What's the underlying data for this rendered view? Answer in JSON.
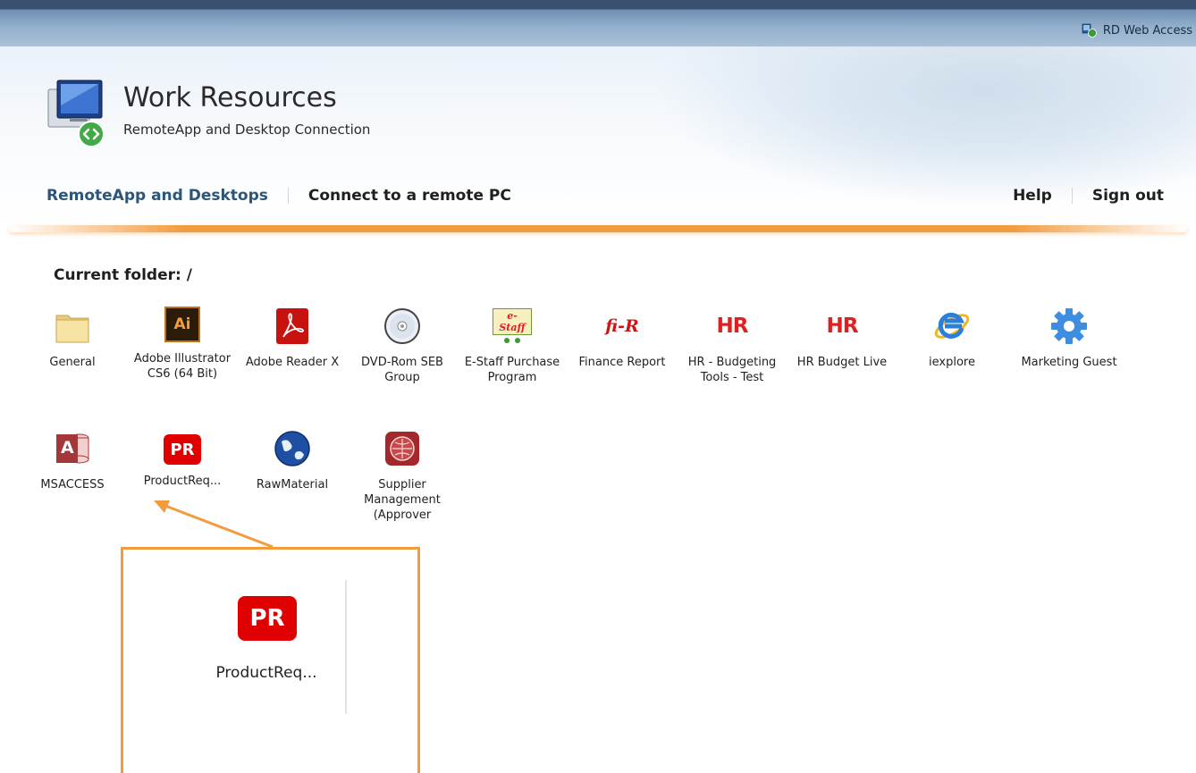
{
  "topbar": {
    "label": "RD Web Access"
  },
  "header": {
    "title": "Work Resources",
    "subtitle": "RemoteApp and Desktop Connection"
  },
  "nav": {
    "left": [
      "RemoteApp and Desktops",
      "Connect to a remote PC"
    ],
    "right": [
      "Help",
      "Sign out"
    ]
  },
  "folder": {
    "label": "Current folder: /"
  },
  "apps": [
    {
      "label": "General",
      "icon": "folder-icon"
    },
    {
      "label": "Adobe Illustrator CS6 (64 Bit)",
      "icon": "illustrator-icon"
    },
    {
      "label": "Adobe Reader X",
      "icon": "acrobat-icon"
    },
    {
      "label": "DVD-Rom SEB Group",
      "icon": "dvd-icon"
    },
    {
      "label": "E-Staff Purchase Program",
      "icon": "estaff-cart-icon"
    },
    {
      "label": "Finance Report",
      "icon": "fi-r-icon"
    },
    {
      "label": "HR - Budgeting Tools - Test",
      "icon": "hr-icon"
    },
    {
      "label": "HR Budget Live",
      "icon": "hr-icon"
    },
    {
      "label": "iexplore",
      "icon": "internet-explorer-icon"
    },
    {
      "label": "Marketing Guest",
      "icon": "gear-icon"
    },
    {
      "label": "MSACCESS",
      "icon": "access-icon"
    },
    {
      "label": "ProductReq...",
      "icon": "pr-icon"
    },
    {
      "label": "RawMaterial",
      "icon": "globe-icon"
    },
    {
      "label": "Supplier Management (Approver",
      "icon": "supplier-icon"
    }
  ],
  "callout": {
    "label": "ProductReq...",
    "icon_text": "PR"
  },
  "icon_text": {
    "illustrator": "Ai",
    "estaff": "e-Staff",
    "finance": "fi-R",
    "hr": "HR",
    "access": "A",
    "pr": "PR"
  },
  "colors": {
    "accent_orange": "#f29b3f",
    "nav_active": "#2c5578",
    "pr_red": "#e10000"
  }
}
